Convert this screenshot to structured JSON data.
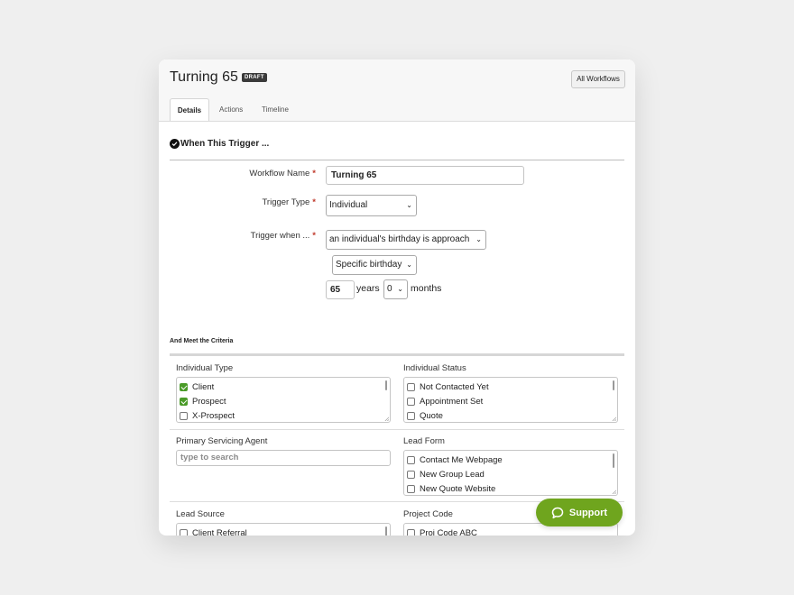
{
  "header": {
    "title": "Turning 65",
    "badge": "DRAFT",
    "all_workflows": "All Workflows"
  },
  "tabs": [
    {
      "label": "Details",
      "active": true
    },
    {
      "label": "Actions",
      "active": false
    },
    {
      "label": "Timeline",
      "active": false
    }
  ],
  "trigger": {
    "section_title": "When This Trigger ...",
    "workflow_name_label": "Workflow Name",
    "workflow_name_value": "Turning 65",
    "trigger_type_label": "Trigger Type",
    "trigger_type_value": "Individual",
    "trigger_when_label": "Trigger when ...",
    "trigger_when_value": "an individual's birthday is approach",
    "birthday_mode_value": "Specific birthday",
    "years_value": "65",
    "years_label": "years",
    "months_value": "0",
    "months_label": "months",
    "required_mark": "*"
  },
  "criteria": {
    "title": "And Meet the Criteria",
    "individual_type": {
      "label": "Individual Type",
      "options": [
        {
          "label": "Client",
          "checked": true
        },
        {
          "label": "Prospect",
          "checked": true
        },
        {
          "label": "X-Prospect",
          "checked": false
        }
      ]
    },
    "individual_status": {
      "label": "Individual Status",
      "options": [
        {
          "label": "Not Contacted Yet",
          "checked": false
        },
        {
          "label": "Appointment Set",
          "checked": false
        },
        {
          "label": "Quote",
          "checked": false
        }
      ]
    },
    "primary_agent": {
      "label": "Primary Servicing Agent",
      "placeholder": "type to search"
    },
    "lead_form": {
      "label": "Lead Form",
      "options": [
        {
          "label": "Contact Me Webpage",
          "checked": false
        },
        {
          "label": "New Group Lead",
          "checked": false
        },
        {
          "label": "New Quote Website",
          "checked": false
        }
      ]
    },
    "lead_source": {
      "label": "Lead Source",
      "options": [
        {
          "label": "Client Referral",
          "checked": false
        }
      ]
    },
    "project_code": {
      "label": "Project Code",
      "options": [
        {
          "label": "Proj Code ABC",
          "checked": false
        }
      ]
    }
  },
  "support": {
    "label": "Support"
  },
  "colors": {
    "accent_green": "#6fa51e",
    "checkbox_green": "#4a9b28",
    "required_red": "#c0392b"
  }
}
